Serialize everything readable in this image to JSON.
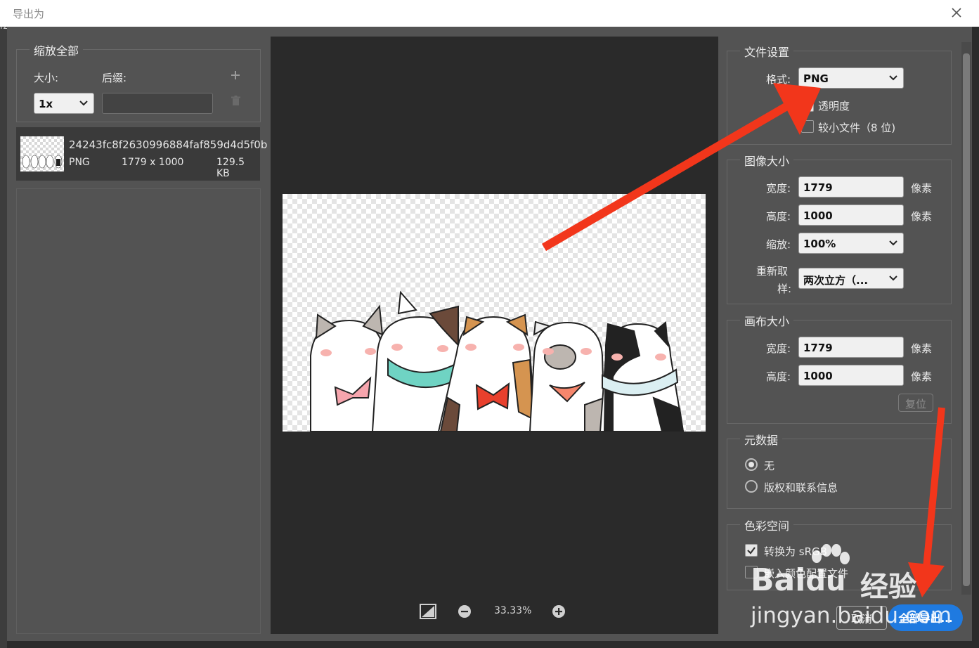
{
  "window": {
    "title": "导出为",
    "edge_char": "f2"
  },
  "left": {
    "scale_group_title": "缩放全部",
    "size_label": "大小:",
    "suffix_label": "后缀:",
    "size_value": "1x",
    "suffix_placeholder": "",
    "asset": {
      "name": "24243fc8f2630996884faf859d4d5f0b",
      "format": "PNG",
      "dims": "1779 x 1000",
      "filesize": "129.5 KB"
    }
  },
  "preview": {
    "zoom": "33.33%"
  },
  "file_settings": {
    "title": "文件设置",
    "format_label": "格式:",
    "format_value": "PNG",
    "transparency_label": "透明度",
    "smaller_file_label": "较小文件（8 位)"
  },
  "image_size": {
    "title": "图像大小",
    "width_label": "宽度:",
    "width_value": "1779",
    "width_unit": "像素",
    "height_label": "高度:",
    "height_value": "1000",
    "height_unit": "像素",
    "scale_label": "缩放:",
    "scale_value": "100%",
    "resample_label_1": "重新取",
    "resample_label_2": "样:",
    "resample_value": "两次立方（..."
  },
  "canvas_size": {
    "title": "画布大小",
    "width_label": "宽度:",
    "width_value": "1779",
    "width_unit": "像素",
    "height_label": "高度:",
    "height_value": "1000",
    "height_unit": "像素",
    "reset_label": "复位"
  },
  "metadata": {
    "title": "元数据",
    "none_label": "无",
    "copyright_label": "版权和联系信息"
  },
  "color_space": {
    "title": "色彩空间",
    "convert_label": "转换为 sRGB",
    "embed_label": "嵌入颜色配置文件"
  },
  "actions": {
    "cancel_label": "取消",
    "export_label": "全部导出..."
  },
  "watermark": {
    "logo": "Bai",
    "logo2": "du",
    "brand": "经验",
    "url": "jingyan.baidu.com"
  },
  "colors": {
    "arrow": "#f2361b",
    "accent": "#1f7ae0"
  }
}
